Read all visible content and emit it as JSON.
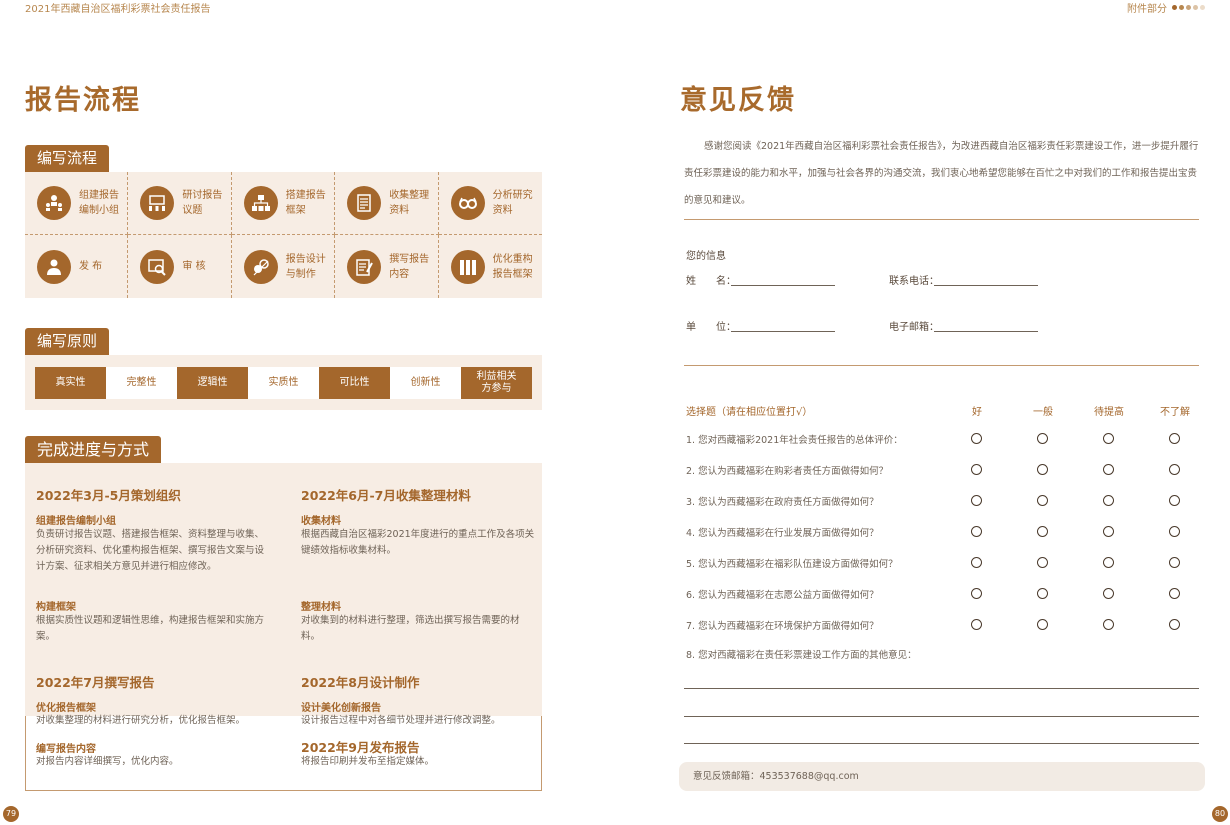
{
  "left": {
    "header": "2021年西藏自治区福利彩票社会责任报告",
    "title": "报告流程",
    "section1": {
      "tab": "编写流程",
      "steps": [
        {
          "label": "组建报告\n编制小组",
          "icon": "team-icon"
        },
        {
          "label": "研讨报告\n议题",
          "icon": "meeting-icon"
        },
        {
          "label": "搭建报告\n框架",
          "icon": "hierarchy-icon"
        },
        {
          "label": "收集整理\n资料",
          "icon": "documents-icon"
        },
        {
          "label": "分析研究\n资料",
          "icon": "glasses-icon"
        },
        {
          "label": "发 布",
          "icon": "publish-icon"
        },
        {
          "label": "审 核",
          "icon": "review-icon"
        },
        {
          "label": "报告设计\n与制作",
          "icon": "design-icon"
        },
        {
          "label": "撰写报告\n内容",
          "icon": "writing-icon"
        },
        {
          "label": "优化重构\n报告框架",
          "icon": "binders-icon"
        }
      ]
    },
    "section2": {
      "tab": "编写原则",
      "principles": [
        "真实性",
        "完整性",
        "逻辑性",
        "实质性",
        "可比性",
        "创新性",
        "利益相关\n方参与"
      ]
    },
    "section3": {
      "tab": "完成进度与方式",
      "c1h": "2022年3月-5月策划组织",
      "c1s1": "组建报告编制小组",
      "c1t1": "负责研讨报告议题、搭建报告框架、资料整理与收集、分析研究资料、优化重构报告框架、撰写报告文案与设计方案、征求相关方意见并进行相应修改。",
      "c1s2": "构建框架",
      "c1t2": "根据实质性议题和逻辑性思维，构建报告框架和实施方案。",
      "c2h": "2022年6月-7月收集整理材料",
      "c2s1": "收集材料",
      "c2t1": "根据西藏自治区福彩2021年度进行的重点工作及各项关键绩效指标收集材料。",
      "c2s2": "整理材料",
      "c2t2": "对收集到的材料进行整理，筛选出撰写报告需要的材料。",
      "c3h": "2022年7月撰写报告",
      "c3s1": "优化报告框架",
      "c3t1": "对收集整理的材料进行研究分析，优化报告框架。",
      "c3s2": "编写报告内容",
      "c3t2": "对报告内容详细撰写，优化内容。",
      "c4h": "2022年8月设计制作",
      "c4s1": "设计美化创新报告",
      "c4t1": "设计报告过程中对各细节处理并进行修改调整。",
      "c5h": "2022年9月发布报告",
      "c5t1": "将报告印刷并发布至指定媒体。"
    },
    "page_number": "79"
  },
  "right": {
    "header": "附件部分",
    "title": "意见反馈",
    "intro": "感谢您阅读《2021年西藏自治区福利彩票社会责任报告》，为改进西藏自治区福彩责任彩票建设工作，进一步提升履行责任彩票建设的能力和水平，加强与社会各界的沟通交流，我们衷心地希望您能够在百忙之中对我们的工作和报告提出宝贵的意见和建议。",
    "info_title": "您的信息",
    "name_label": "姓　　名：",
    "phone_label": "联系电话：",
    "unit_label": "单　　位：",
    "email_label": "电子邮箱：",
    "choice_title": "选择题（请在相应位置打√）",
    "choices": [
      "好",
      "一般",
      "待提高",
      "不了解"
    ],
    "questions": [
      "1.  您对西藏福彩2021年社会责任报告的总体评价：",
      "2.  您认为西藏福彩在购彩者责任方面做得如何？",
      "3.  您认为西藏福彩在政府责任方面做得如何？",
      "4.  您认为西藏福彩在行业发展方面做得如何？",
      "5.  您认为西藏福彩在福彩队伍建设方面做得如何？",
      "6.  您认为西藏福彩在志愿公益方面做得如何？",
      "7.  您认为西藏福彩在环境保护方面做得如何？"
    ],
    "q8": "8.  您对西藏福彩在责任彩票建设工作方面的其他意见：",
    "footer_email": "意见反馈邮箱：453537688@qq.com",
    "page_number": "80"
  },
  "colors": {
    "accent": "#a4672c",
    "beige": "#f7ede4"
  }
}
